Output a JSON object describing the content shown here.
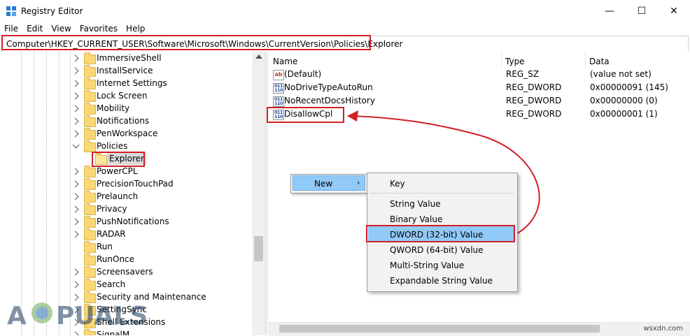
{
  "window": {
    "title": "Registry Editor",
    "minimize": "—",
    "maximize": "☐",
    "close": "✕"
  },
  "menu": [
    "File",
    "Edit",
    "View",
    "Favorites",
    "Help"
  ],
  "address": "Computer\\HKEY_CURRENT_USER\\Software\\Microsoft\\Windows\\CurrentVersion\\Policies\\Explorer",
  "tree": {
    "items": [
      {
        "label": "ImmersiveShell",
        "expandable": true
      },
      {
        "label": "InstallService",
        "expandable": true
      },
      {
        "label": "Internet Settings",
        "expandable": true
      },
      {
        "label": "Lock Screen",
        "expandable": true
      },
      {
        "label": "Mobility",
        "expandable": true
      },
      {
        "label": "Notifications",
        "expandable": true
      },
      {
        "label": "PenWorkspace",
        "expandable": true
      },
      {
        "label": "Policies",
        "expanded": true
      },
      {
        "label": "Explorer",
        "selected": true
      },
      {
        "label": "PowerCPL",
        "expandable": true
      },
      {
        "label": "PrecisionTouchPad",
        "expandable": true
      },
      {
        "label": "Prelaunch",
        "expandable": true
      },
      {
        "label": "Privacy",
        "expandable": true
      },
      {
        "label": "PushNotifications",
        "expandable": true
      },
      {
        "label": "RADAR",
        "expandable": true
      },
      {
        "label": "Run",
        "expandable": false
      },
      {
        "label": "RunOnce",
        "expandable": false
      },
      {
        "label": "Screensavers",
        "expandable": true
      },
      {
        "label": "Search",
        "expandable": true
      },
      {
        "label": "Security and Maintenance",
        "expandable": true
      },
      {
        "label": "SettingSync",
        "expandable": true
      },
      {
        "label": "Shell Extensions",
        "expandable": true
      },
      {
        "label": "SignalM",
        "expandable": true
      }
    ]
  },
  "list": {
    "columns": {
      "name": "Name",
      "type": "Type",
      "data": "Data"
    },
    "rows": [
      {
        "name": "(Default)",
        "type": "REG_SZ",
        "data": "(value not set)",
        "icon": "string"
      },
      {
        "name": "NoDriveTypeAutoRun",
        "type": "REG_DWORD",
        "data": "0x00000091 (145)",
        "icon": "binary"
      },
      {
        "name": "NoRecentDocsHistory",
        "type": "REG_DWORD",
        "data": "0x00000000 (0)",
        "icon": "binary"
      },
      {
        "name": "DisallowCpl",
        "type": "REG_DWORD",
        "data": "0x00000001 (1)",
        "icon": "binary"
      }
    ]
  },
  "context_menu": {
    "new_label": "New",
    "submenu": [
      "Key",
      "String Value",
      "Binary Value",
      "DWORD (32-bit) Value",
      "QWORD (64-bit) Value",
      "Multi-String Value",
      "Expandable String Value"
    ]
  },
  "icons": {
    "ab": "ab",
    "bin": "011\n110"
  },
  "watermark": "A PUALS",
  "site": "wsxdn.com",
  "colors": {
    "highlight_red": "#d21f26",
    "menu_hover": "#91c9f7",
    "folder": "#f8d775"
  }
}
